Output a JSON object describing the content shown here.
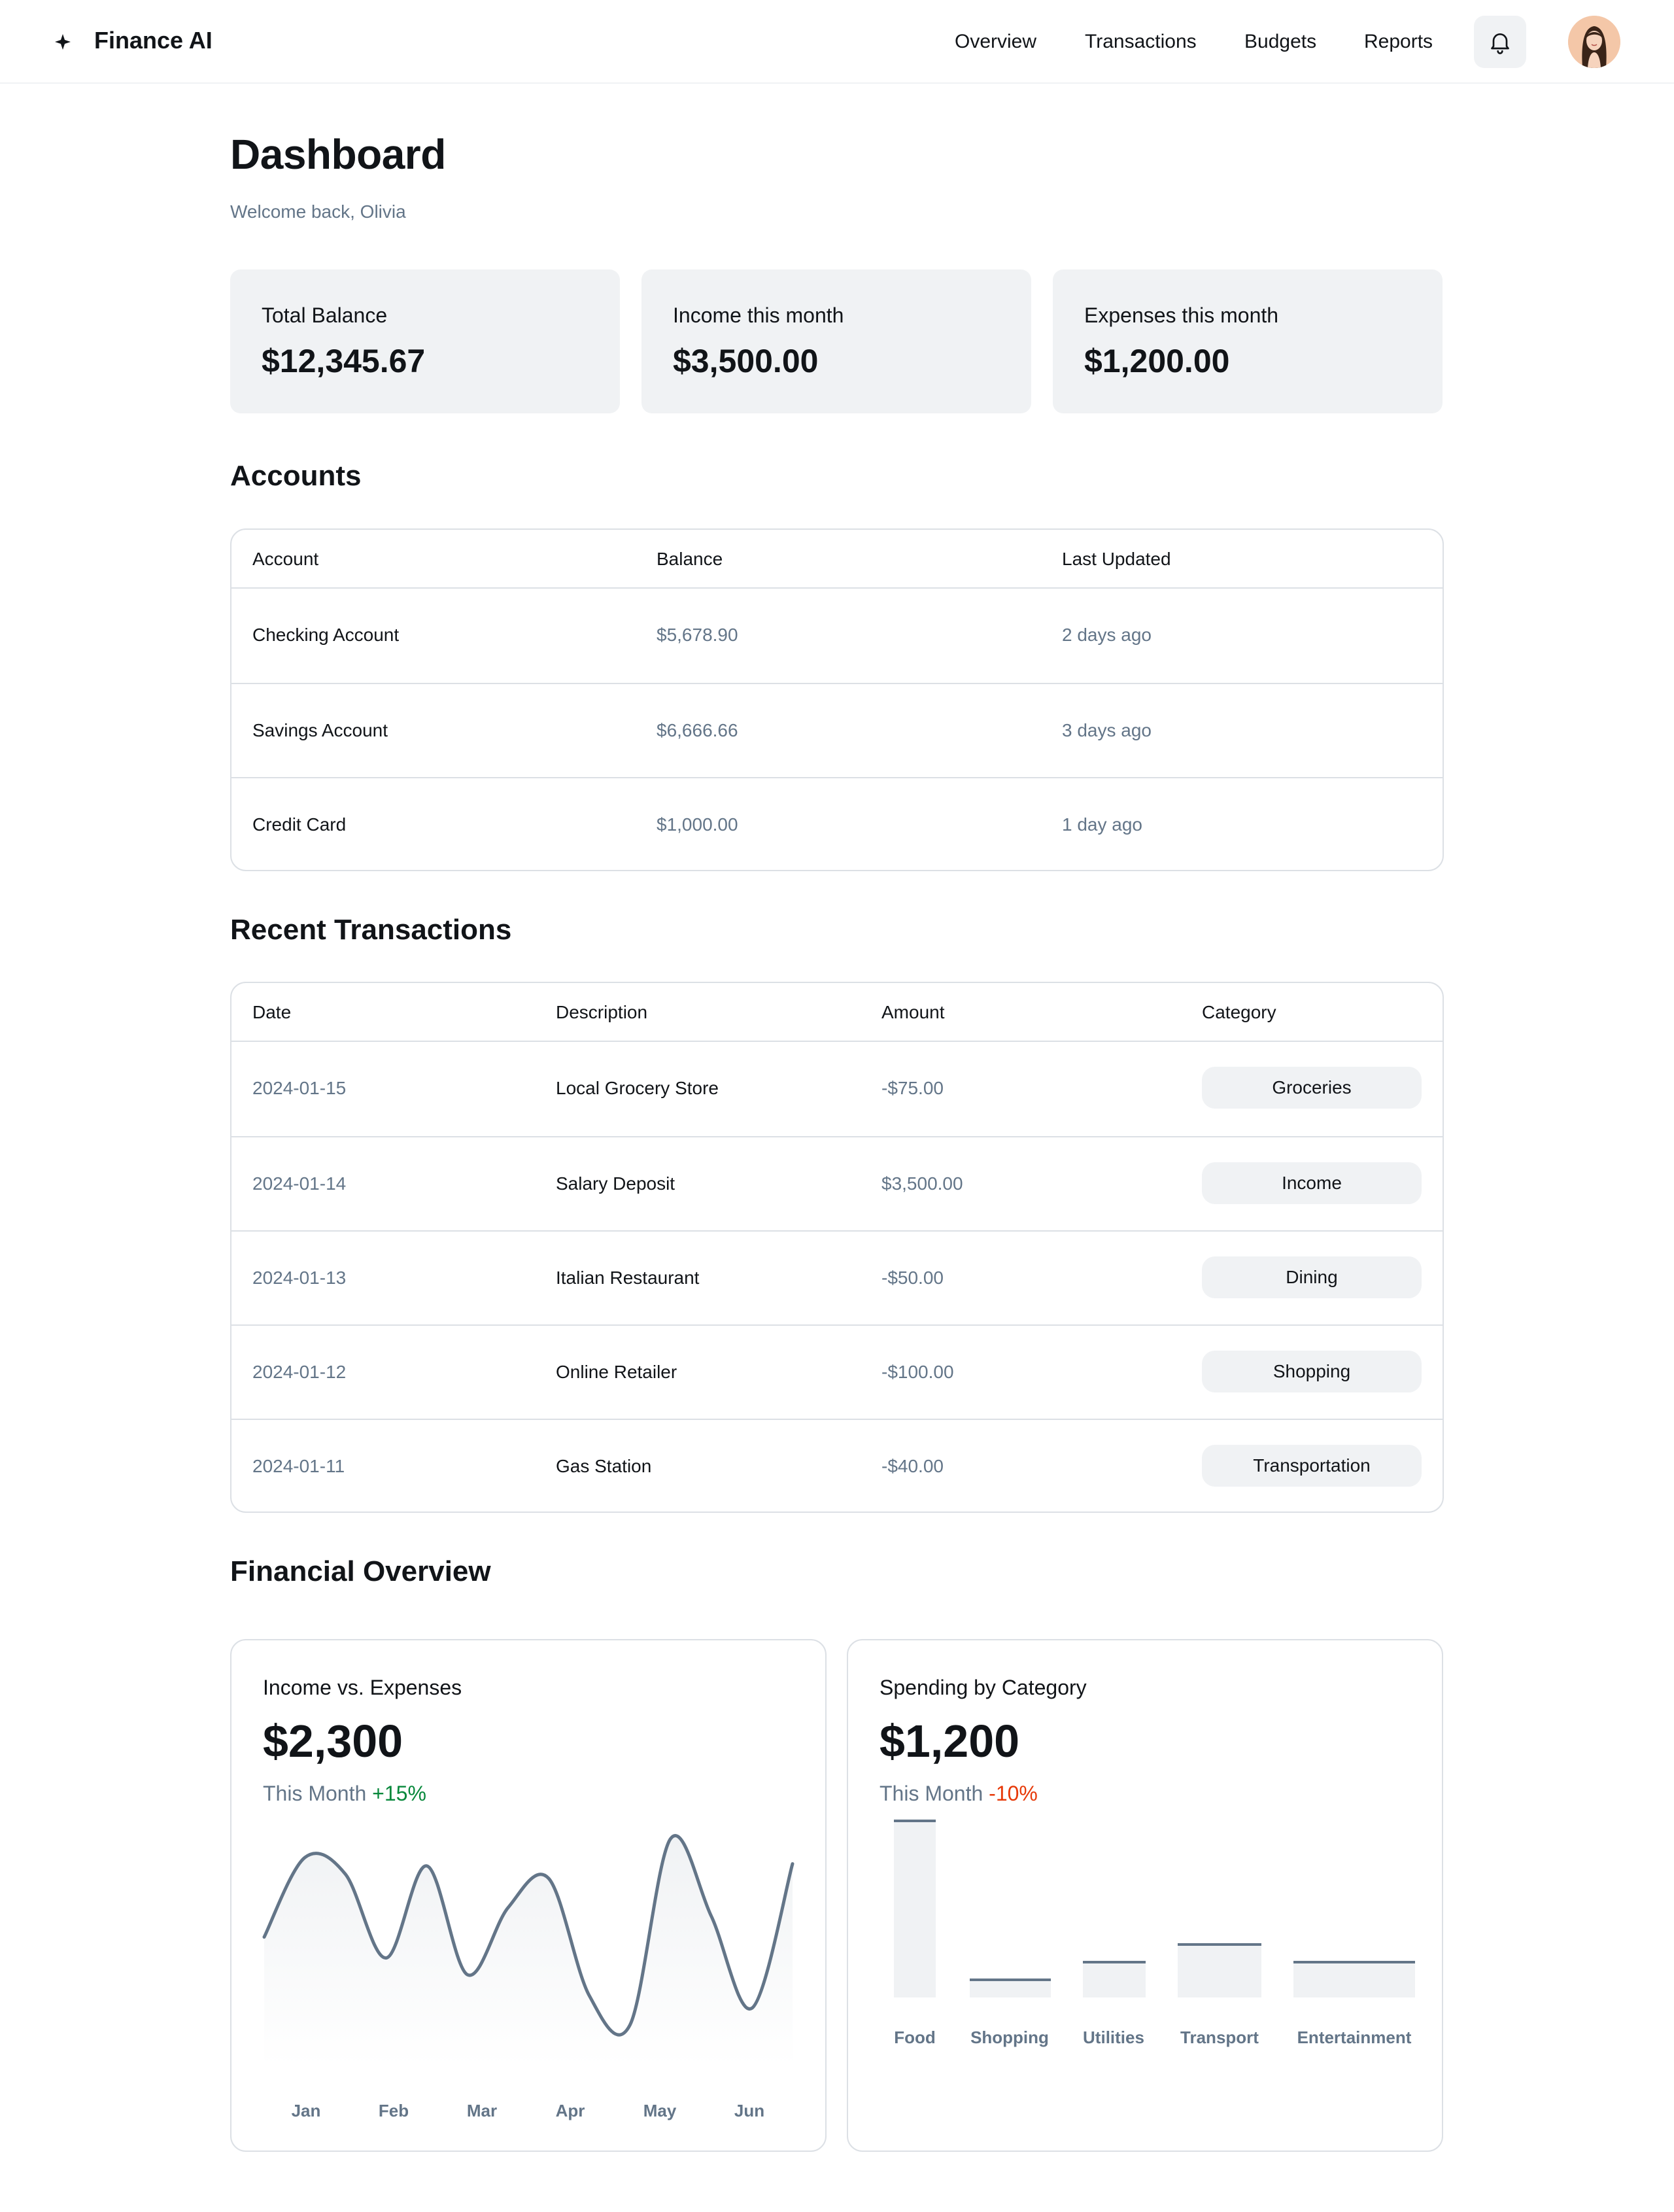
{
  "header": {
    "logo_icon": "sparkle-icon",
    "app_title": "Finance AI",
    "nav": [
      "Overview",
      "Transactions",
      "Budgets",
      "Reports"
    ],
    "bell_icon": "bell-icon",
    "avatar_icon": "user-avatar"
  },
  "page": {
    "title": "Dashboard",
    "welcome": "Welcome back, Olivia"
  },
  "stats": [
    {
      "label": "Total Balance",
      "value": "$12,345.67"
    },
    {
      "label": "Income this month",
      "value": "$3,500.00"
    },
    {
      "label": "Expenses this month",
      "value": "$1,200.00"
    }
  ],
  "accounts": {
    "title": "Accounts",
    "columns": [
      "Account",
      "Balance",
      "Last Updated"
    ],
    "rows": [
      [
        "Checking Account",
        "$5,678.90",
        "2 days ago"
      ],
      [
        "Savings Account",
        "$6,666.66",
        "3 days ago"
      ],
      [
        "Credit Card",
        "$1,000.00",
        "1 day ago"
      ]
    ]
  },
  "transactions": {
    "title": "Recent Transactions",
    "columns": [
      "Date",
      "Description",
      "Amount",
      "Category"
    ],
    "rows": [
      [
        "2024-01-15",
        "Local Grocery Store",
        "-$75.00",
        "Groceries"
      ],
      [
        "2024-01-14",
        "Salary Deposit",
        "$3,500.00",
        "Income"
      ],
      [
        "2024-01-13",
        "Italian Restaurant",
        "-$50.00",
        "Dining"
      ],
      [
        "2024-01-12",
        "Online Retailer",
        "-$100.00",
        "Shopping"
      ],
      [
        "2024-01-11",
        "Gas Station",
        "-$40.00",
        "Transportation"
      ]
    ]
  },
  "overview": {
    "title": "Financial Overview",
    "income_card": {
      "label": "Income vs. Expenses",
      "value": "$2,300",
      "period": "This Month",
      "change": "+15%"
    },
    "spending_card": {
      "label": "Spending by Category",
      "value": "$1,200",
      "period": "This Month",
      "change": "-10%"
    }
  },
  "colors": {
    "text": "#111418",
    "muted": "#637588",
    "surface": "#f0f2f4",
    "border": "#dce0e5",
    "positive": "#07883b",
    "negative": "#e73908",
    "line": "#637588"
  },
  "chart_data": [
    {
      "type": "line",
      "x": [
        "Jan",
        "Feb",
        "Mar",
        "Apr",
        "May",
        "Jun"
      ],
      "series": [
        {
          "values": [
            0.52,
            0.9,
            0.82,
            0.42,
            0.86,
            0.34,
            0.66,
            0.8,
            0.24,
            0.1,
            0.99,
            0.62,
            0.18,
            0.87
          ]
        }
      ],
      "grid": false
    },
    {
      "type": "bar",
      "categories": [
        "Food",
        "Shopping",
        "Utilities",
        "Transport",
        "Entertainment"
      ],
      "values": [
        100,
        10,
        20,
        30,
        20
      ],
      "grid": false
    }
  ]
}
